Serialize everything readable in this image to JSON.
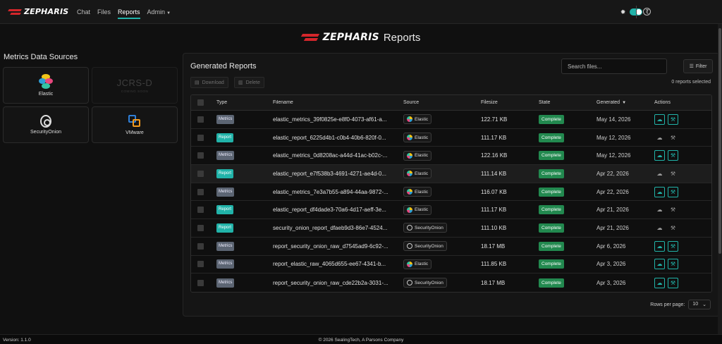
{
  "nav": {
    "brand": "ZEPHARIS",
    "links": [
      "Chat",
      "Files",
      "Reports",
      "Admin"
    ],
    "active": "Reports"
  },
  "page": {
    "brand": "ZEPHARIS",
    "title": "Reports"
  },
  "sources": {
    "title": "Metrics Data Sources",
    "cards": [
      {
        "label": "Elastic",
        "icon": "elastic-icon"
      },
      {
        "label": "JCRS-D",
        "sublabel": "COMING SOON",
        "disabled": true
      },
      {
        "label": "SecurityOnion",
        "icon": "security-onion-icon"
      },
      {
        "label": "VMware",
        "icon": "vmware-icon"
      }
    ]
  },
  "reports": {
    "title": "Generated Reports",
    "search_placeholder": "Search files...",
    "filter_label": "Filter",
    "download_label": "Download",
    "delete_label": "Delete",
    "selected_text": "0 reports selected",
    "columns": [
      "Type",
      "Filename",
      "Source",
      "Filesize",
      "State",
      "Generated",
      "Actions"
    ],
    "rows": [
      {
        "type": "Metrics",
        "filename": "elastic_metrics_39f0825e-e8f0-4073-af61-a...",
        "source": "Elastic",
        "size": "122.71 KB",
        "state": "Complete",
        "date": "May 14, 2026",
        "actions_active": true
      },
      {
        "type": "Report",
        "filename": "elastic_report_6225d4b1-c0b4-40b6-820f-0...",
        "source": "Elastic",
        "size": "111.17 KB",
        "state": "Complete",
        "date": "May 12, 2026",
        "actions_active": false
      },
      {
        "type": "Metrics",
        "filename": "elastic_metrics_0d8208ac-a44d-41ac-b02c-...",
        "source": "Elastic",
        "size": "122.16 KB",
        "state": "Complete",
        "date": "May 12, 2026",
        "actions_active": true
      },
      {
        "type": "Report",
        "filename": "elastic_report_e7f538b3-4691-4271-ae4d-0...",
        "source": "Elastic",
        "size": "111.14 KB",
        "state": "Complete",
        "date": "Apr 22, 2026",
        "actions_active": false
      },
      {
        "type": "Metrics",
        "filename": "elastic_metrics_7e3a7b55-a894-44aa-9872-...",
        "source": "Elastic",
        "size": "116.07 KB",
        "state": "Complete",
        "date": "Apr 22, 2026",
        "actions_active": true
      },
      {
        "type": "Report",
        "filename": "elastic_report_df4dade3-70a6-4d17-aeff-3e...",
        "source": "Elastic",
        "size": "111.17 KB",
        "state": "Complete",
        "date": "Apr 21, 2026",
        "actions_active": false
      },
      {
        "type": "Report",
        "filename": "security_onion_report_dfaeb9d3-86e7-4524...",
        "source": "SecurityOnion",
        "size": "111.10 KB",
        "state": "Complete",
        "date": "Apr 21, 2026",
        "actions_active": false
      },
      {
        "type": "Metrics",
        "filename": "report_security_onion_raw_d7545ad9-6c92-...",
        "source": "SecurityOnion",
        "size": "18.17 MB",
        "state": "Complete",
        "date": "Apr 6, 2026",
        "actions_active": true
      },
      {
        "type": "Metrics",
        "filename": "report_elastic_raw_4065d655-ee67-4341-b...",
        "source": "Elastic",
        "size": "111.85 KB",
        "state": "Complete",
        "date": "Apr 3, 2026",
        "actions_active": true
      },
      {
        "type": "Metrics",
        "filename": "report_security_onion_raw_cde22b2a-3031-...",
        "source": "SecurityOnion",
        "size": "18.17 MB",
        "state": "Complete",
        "date": "Apr 3, 2026",
        "actions_active": true
      }
    ],
    "rows_per_page_label": "Rows per page:",
    "rows_per_page": "10"
  },
  "footer": {
    "version": "Version: 1.1.0",
    "copyright": "© 2026 SealingTech, A Parsons Company"
  },
  "colors": {
    "accent": "#21b3a9",
    "complete": "#22894f",
    "metrics": "#5c6573",
    "brand_red": "#d4262b"
  }
}
